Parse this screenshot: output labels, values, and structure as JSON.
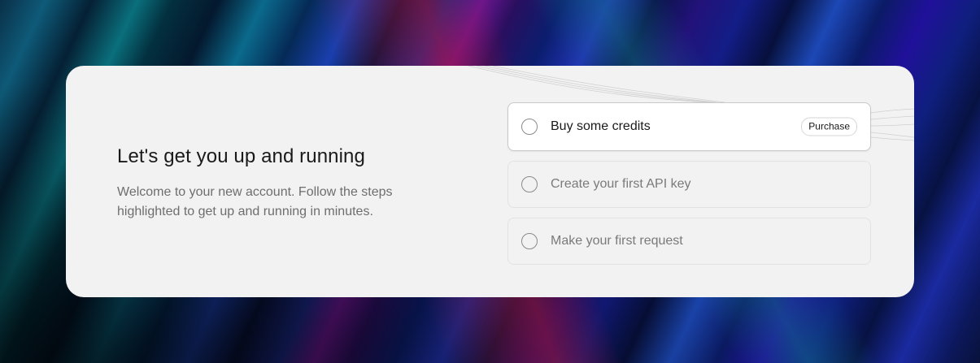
{
  "onboarding": {
    "title": "Let's get you up and running",
    "subtitle": "Welcome to your new account. Follow the steps highlighted to get up and running in minutes.",
    "steps": [
      {
        "label": "Buy some credits",
        "action_label": "Purchase",
        "active": true,
        "completed": false
      },
      {
        "label": "Create your first API key",
        "active": false,
        "completed": false
      },
      {
        "label": "Make your first request",
        "active": false,
        "completed": false
      }
    ]
  },
  "colors": {
    "card_background": "#f2f2f2",
    "active_step_background": "#ffffff",
    "title_text": "#1a1a1a",
    "muted_text": "#6e6e6e"
  },
  "icons": {
    "step_status": "empty-circle-icon"
  }
}
